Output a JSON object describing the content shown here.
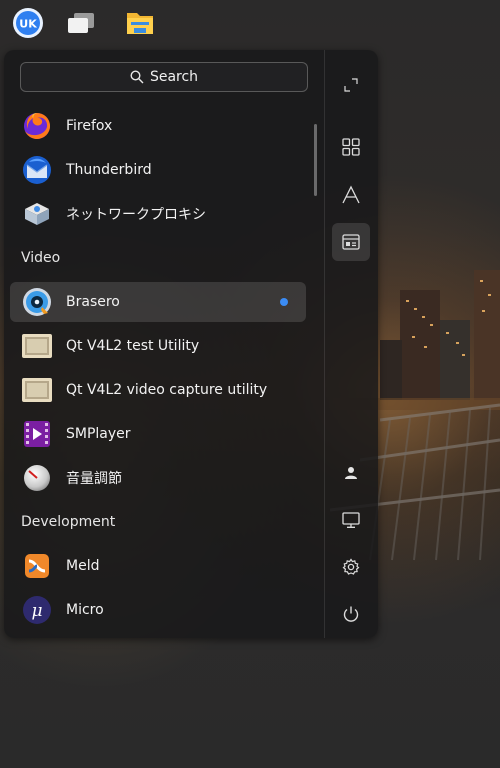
{
  "taskbar": {
    "start_icon": "kylin-start-icon",
    "multitask_icon": "multitask-icon",
    "files_icon": "file-manager-icon"
  },
  "search": {
    "label": "Search",
    "icon": "search-icon"
  },
  "apps": [
    {
      "label": "Firefox",
      "icon": "firefox-icon"
    },
    {
      "label": "Thunderbird",
      "icon": "thunderbird-icon"
    },
    {
      "label": "ネットワークプロキシ",
      "icon": "network-proxy-icon"
    }
  ],
  "category_video": "Video",
  "video_apps": [
    {
      "label": "Brasero",
      "icon": "brasero-icon",
      "highlighted": true,
      "new_badge": true
    },
    {
      "label": "Qt V4L2 test Utility",
      "icon": "qt-v4l2-icon"
    },
    {
      "label": "Qt V4L2 video capture utility",
      "icon": "qt-v4l2-icon"
    },
    {
      "label": "SMPlayer",
      "icon": "smplayer-icon"
    },
    {
      "label": "音量調節",
      "icon": "volume-control-icon"
    }
  ],
  "category_development": "Development",
  "dev_apps": [
    {
      "label": "Meld",
      "icon": "meld-icon"
    },
    {
      "label": "Micro",
      "icon": "micro-icon"
    }
  ],
  "sidebar": [
    "expand-icon",
    "all-apps-grid-icon",
    "letter-sort-icon",
    "category-view-icon",
    "user-icon",
    "computer-icon",
    "settings-gear-icon",
    "power-icon"
  ],
  "colors": {
    "accent": "#3b8cf5",
    "panel": "#18181a"
  }
}
